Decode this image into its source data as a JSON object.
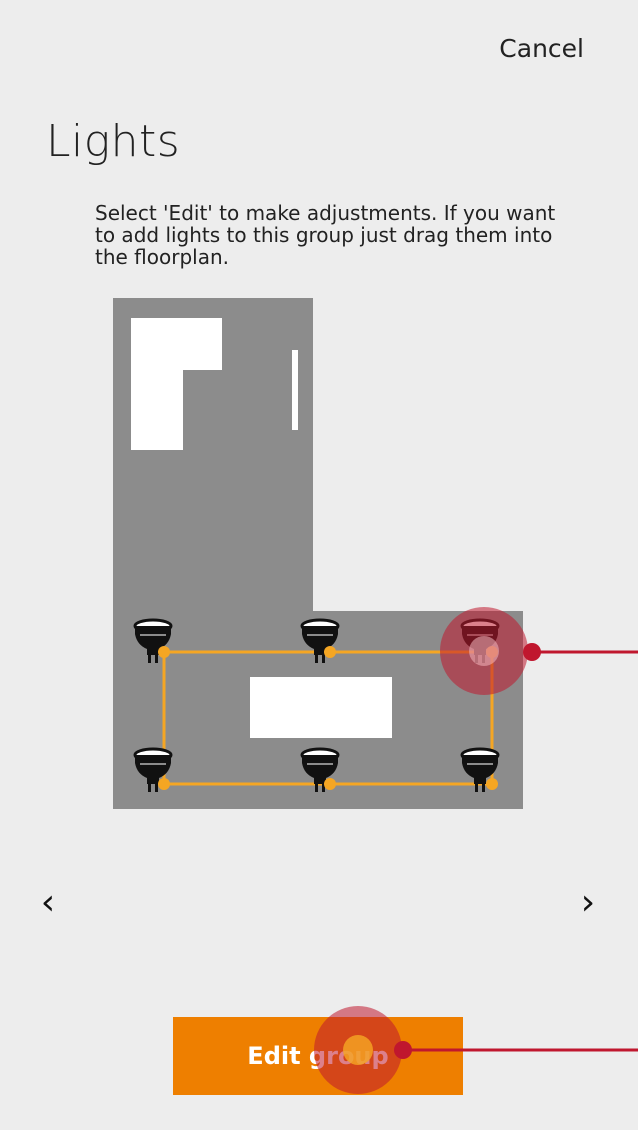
{
  "header": {
    "cancel_label": "Cancel"
  },
  "page": {
    "title": "Lights",
    "description": "Select 'Edit' to make adjustments. If you want to add lights to this group just drag them into the floorplan."
  },
  "floorplan": {
    "lights": [
      {
        "name": "light-1"
      },
      {
        "name": "light-2"
      },
      {
        "name": "light-3"
      },
      {
        "name": "light-4"
      },
      {
        "name": "light-5"
      },
      {
        "name": "light-6"
      }
    ],
    "colors": {
      "floor": "#8c8c8c",
      "furniture": "#ffffff",
      "group_outline": "#f5a623"
    }
  },
  "navigation": {
    "prev_glyph": "‹",
    "next_glyph": "›"
  },
  "actions": {
    "edit_group_label": "Edit group"
  },
  "colors": {
    "accent": "#ee7f00",
    "touch_indicator": "#c0172e"
  }
}
